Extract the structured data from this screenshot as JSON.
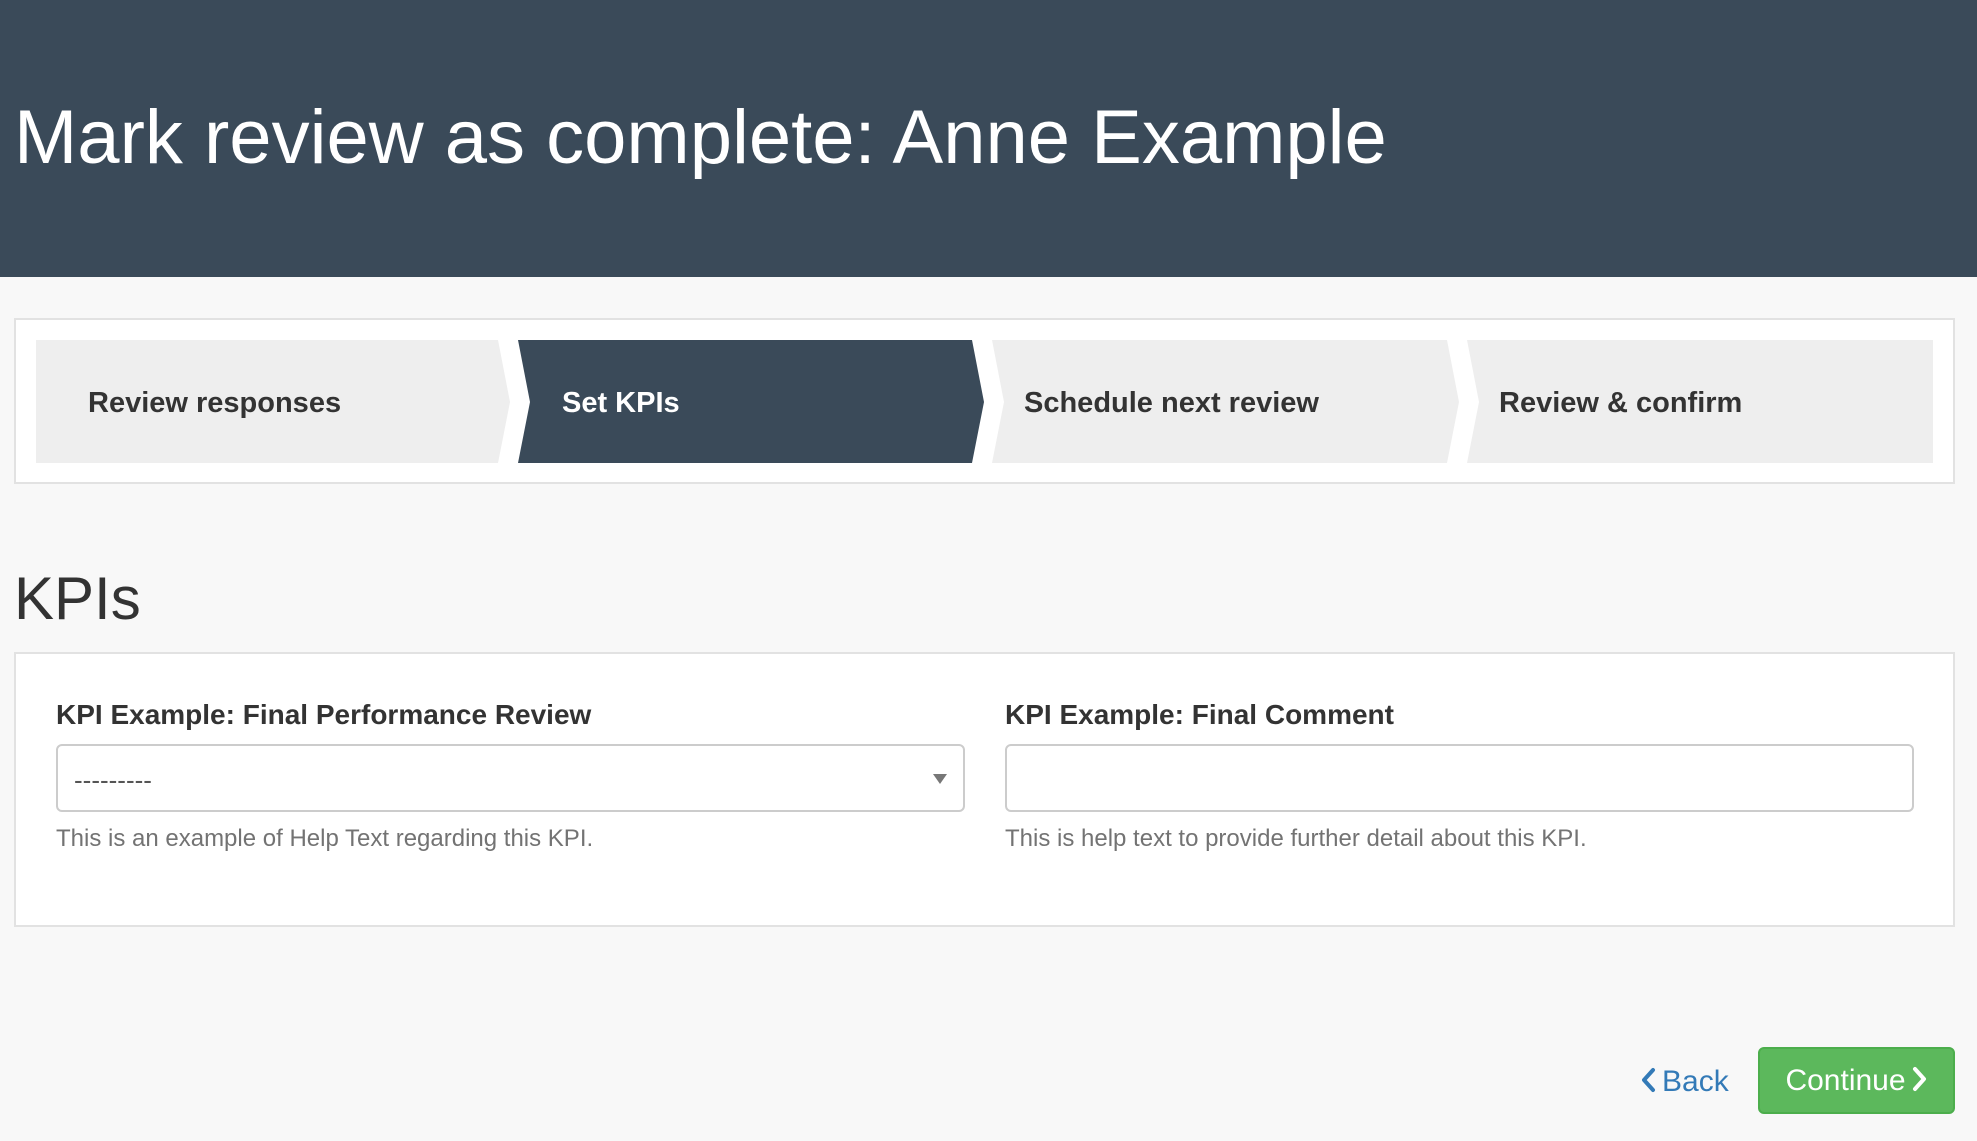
{
  "header": {
    "title": "Mark review as complete: Anne Example"
  },
  "steps": [
    {
      "label": "Review responses",
      "active": false
    },
    {
      "label": "Set KPIs",
      "active": true
    },
    {
      "label": "Schedule next review",
      "active": false
    },
    {
      "label": "Review & confirm",
      "active": false
    }
  ],
  "section": {
    "title": "KPIs"
  },
  "kpis": [
    {
      "label": "KPI Example: Final Performance Review",
      "type": "select",
      "value": "---------",
      "help": "This is an example of Help Text regarding this KPI."
    },
    {
      "label": "KPI Example: Final Comment",
      "type": "text",
      "value": "",
      "help": "This is help text to provide further detail about this KPI."
    }
  ],
  "actions": {
    "back_label": "Back",
    "continue_label": "Continue"
  },
  "colors": {
    "header_bg": "#3a4a59",
    "step_active_bg": "#3a4a59",
    "step_inactive_bg": "#eeeeee",
    "continue_bg": "#5cb85c",
    "link": "#337ab7"
  },
  "icons": {
    "back": "chevron-left-icon",
    "continue": "chevron-right-icon",
    "dropdown": "caret-down-icon"
  }
}
